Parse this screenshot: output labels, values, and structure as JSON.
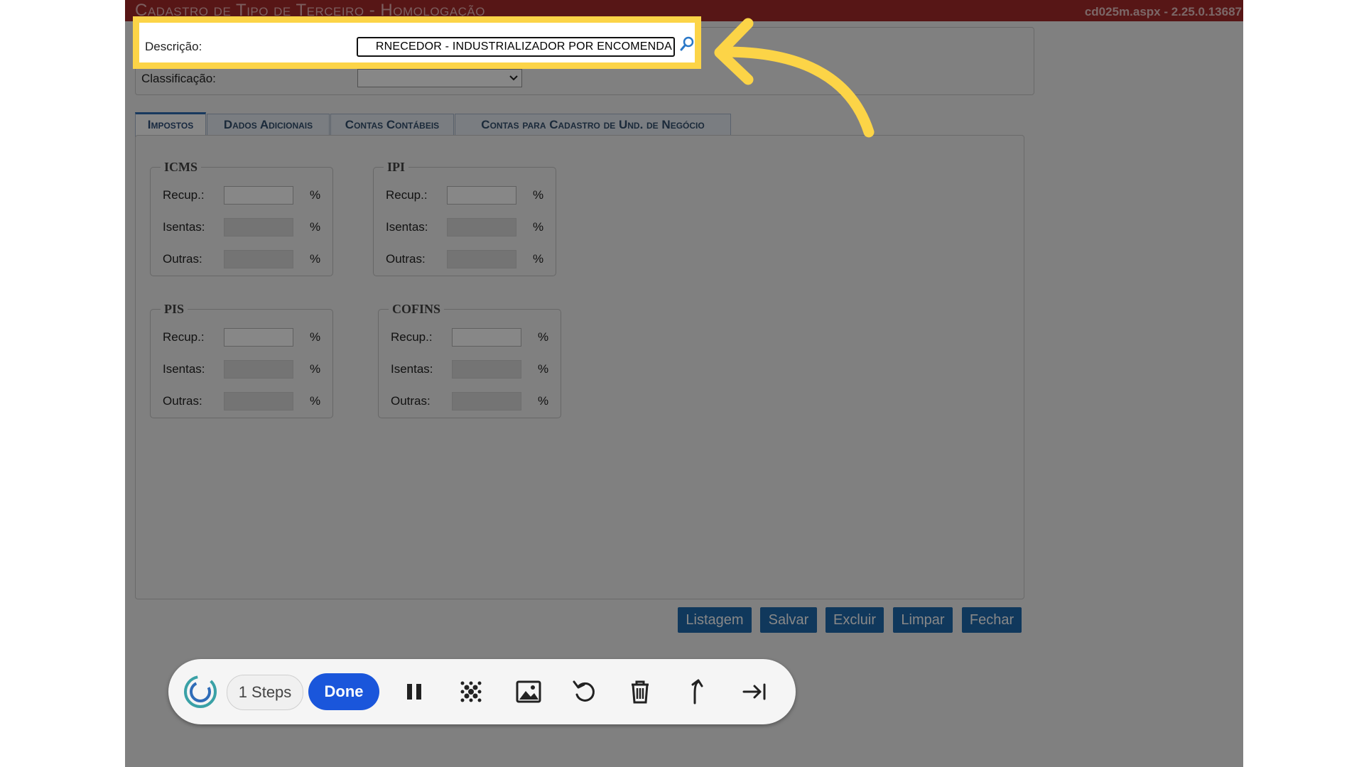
{
  "window": {
    "title": "Cadastro de Tipo de Terceiro - Homologação",
    "version": "cd025m.aspx - 2.25.0.13687"
  },
  "form": {
    "descricao_label": "Descrição:",
    "descricao_value": "RNECEDOR - INDUSTRIALIZADOR POR ENCOMENDA",
    "classificacao_label": "Classificação:"
  },
  "tabs": [
    {
      "label": "Impostos",
      "active": true
    },
    {
      "label": "Dados Adicionais",
      "active": false
    },
    {
      "label": "Contas Contábeis",
      "active": false
    },
    {
      "label": "Contas para Cadastro de Und. de Negócio",
      "active": false
    }
  ],
  "taxes": {
    "recup_label": "Recup.:",
    "isentas_label": "Isentas:",
    "outras_label": "Outras:",
    "percent_symbol": "%",
    "icms_title": "ICMS",
    "ipi_title": "IPI",
    "pis_title": "PIS",
    "cofins_title": "COFINS"
  },
  "buttons": {
    "listagem": "Listagem",
    "salvar": "Salvar",
    "excluir": "Excluir",
    "limpar": "Limpar",
    "fechar": "Fechar"
  },
  "recorder": {
    "steps_label": "1 Steps",
    "done_label": "Done"
  },
  "colors": {
    "title_bar": "#a52a2a",
    "button_blue": "#1f6aaf",
    "highlight_yellow": "#fcd447",
    "done_blue": "#1a56db"
  }
}
